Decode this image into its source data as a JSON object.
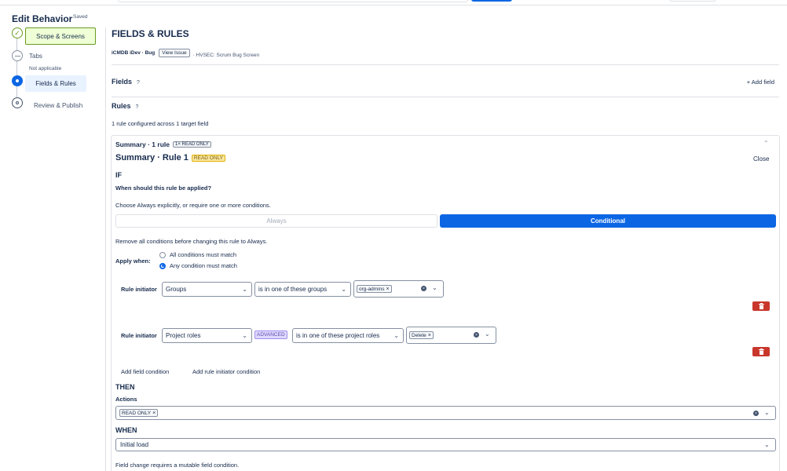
{
  "wizard": {
    "title": "Edit Behavior",
    "saved_label": "Saved",
    "steps": [
      {
        "label": "Scope & Screens",
        "state": "done",
        "marker": "✓"
      },
      {
        "label": "Tabs",
        "state": "skipped",
        "sublabel": "Not applicable"
      },
      {
        "label": "Fields & Rules",
        "state": "current"
      },
      {
        "label": "Review & Publish",
        "state": "todo"
      }
    ]
  },
  "main": {
    "title": "FIELDS & RULES",
    "context": {
      "project": "iCMDB iDev · Bug",
      "view_issue": "View Issue",
      "screen": "· HVSEC: Scrum Bug Screen"
    },
    "fields_label": "Fields",
    "help_mark": "?",
    "add_field": "+ Add field",
    "rules_label": "Rules",
    "rules_summary": "1 rule configured across 1 target field"
  },
  "rule": {
    "header": "Summary · 1 rule",
    "header_badge": "1× READ ONLY",
    "collapse_glyph": "⌃",
    "title": "Summary · Rule 1",
    "title_badge": "READ ONLY",
    "close": "Close",
    "if_label": "IF",
    "question": "When should this rule be applied?",
    "choose_text": "Choose Always explicitly, or require one or more conditions.",
    "mode_always": "Always",
    "mode_conditional": "Conditional",
    "remove_note": "Remove all conditions before changing this rule to Always.",
    "apply_when": "Apply when:",
    "match_all": "All conditions must match",
    "match_any": "Any condition must match",
    "selected_match": "any",
    "conditions": [
      {
        "label": "Rule initiator",
        "type": "Groups",
        "operator": "is in one of these groups",
        "values": [
          "org-admins"
        ]
      },
      {
        "label": "Rule initiator",
        "type": "Project roles",
        "badge": "ADVANCED",
        "operator": "is in one of these project roles",
        "values": [
          "Delete"
        ]
      }
    ],
    "add_field_condition": "Add field condition",
    "add_initiator_condition": "Add rule initiator condition",
    "then_label": "THEN",
    "actions_label": "Actions",
    "actions": [
      "READ ONLY"
    ],
    "when_label": "WHEN",
    "when_value": "Initial load",
    "footer_note": "Field change requires a mutable field condition."
  },
  "icons": {
    "chevron_down": "⌄",
    "remove_tag": "×",
    "clear": "×"
  },
  "colors": {
    "primary": "#0c66e4",
    "done_green": "#6a9a23",
    "danger": "#c9372c",
    "readonly_badge": "#f8e6a0",
    "advanced_badge": "#dfd8fd"
  }
}
